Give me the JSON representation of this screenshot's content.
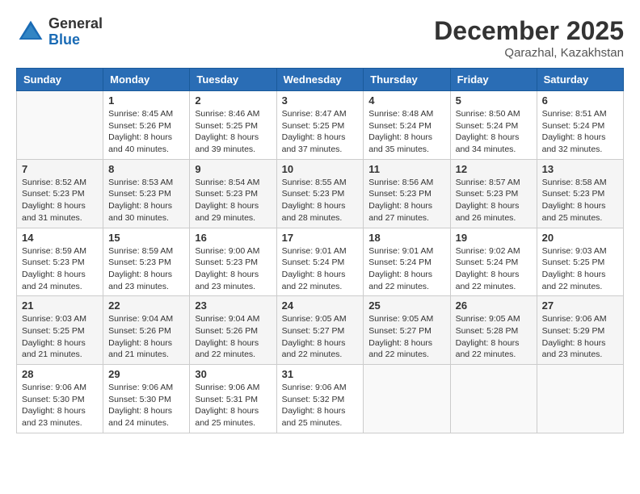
{
  "header": {
    "logo_general": "General",
    "logo_blue": "Blue",
    "month": "December 2025",
    "location": "Qarazhal, Kazakhstan"
  },
  "days_of_week": [
    "Sunday",
    "Monday",
    "Tuesday",
    "Wednesday",
    "Thursday",
    "Friday",
    "Saturday"
  ],
  "weeks": [
    [
      {
        "day": "",
        "sunrise": "",
        "sunset": "",
        "daylight": ""
      },
      {
        "day": "1",
        "sunrise": "Sunrise: 8:45 AM",
        "sunset": "Sunset: 5:26 PM",
        "daylight": "Daylight: 8 hours and 40 minutes."
      },
      {
        "day": "2",
        "sunrise": "Sunrise: 8:46 AM",
        "sunset": "Sunset: 5:25 PM",
        "daylight": "Daylight: 8 hours and 39 minutes."
      },
      {
        "day": "3",
        "sunrise": "Sunrise: 8:47 AM",
        "sunset": "Sunset: 5:25 PM",
        "daylight": "Daylight: 8 hours and 37 minutes."
      },
      {
        "day": "4",
        "sunrise": "Sunrise: 8:48 AM",
        "sunset": "Sunset: 5:24 PM",
        "daylight": "Daylight: 8 hours and 35 minutes."
      },
      {
        "day": "5",
        "sunrise": "Sunrise: 8:50 AM",
        "sunset": "Sunset: 5:24 PM",
        "daylight": "Daylight: 8 hours and 34 minutes."
      },
      {
        "day": "6",
        "sunrise": "Sunrise: 8:51 AM",
        "sunset": "Sunset: 5:24 PM",
        "daylight": "Daylight: 8 hours and 32 minutes."
      }
    ],
    [
      {
        "day": "7",
        "sunrise": "Sunrise: 8:52 AM",
        "sunset": "Sunset: 5:23 PM",
        "daylight": "Daylight: 8 hours and 31 minutes."
      },
      {
        "day": "8",
        "sunrise": "Sunrise: 8:53 AM",
        "sunset": "Sunset: 5:23 PM",
        "daylight": "Daylight: 8 hours and 30 minutes."
      },
      {
        "day": "9",
        "sunrise": "Sunrise: 8:54 AM",
        "sunset": "Sunset: 5:23 PM",
        "daylight": "Daylight: 8 hours and 29 minutes."
      },
      {
        "day": "10",
        "sunrise": "Sunrise: 8:55 AM",
        "sunset": "Sunset: 5:23 PM",
        "daylight": "Daylight: 8 hours and 28 minutes."
      },
      {
        "day": "11",
        "sunrise": "Sunrise: 8:56 AM",
        "sunset": "Sunset: 5:23 PM",
        "daylight": "Daylight: 8 hours and 27 minutes."
      },
      {
        "day": "12",
        "sunrise": "Sunrise: 8:57 AM",
        "sunset": "Sunset: 5:23 PM",
        "daylight": "Daylight: 8 hours and 26 minutes."
      },
      {
        "day": "13",
        "sunrise": "Sunrise: 8:58 AM",
        "sunset": "Sunset: 5:23 PM",
        "daylight": "Daylight: 8 hours and 25 minutes."
      }
    ],
    [
      {
        "day": "14",
        "sunrise": "Sunrise: 8:59 AM",
        "sunset": "Sunset: 5:23 PM",
        "daylight": "Daylight: 8 hours and 24 minutes."
      },
      {
        "day": "15",
        "sunrise": "Sunrise: 8:59 AM",
        "sunset": "Sunset: 5:23 PM",
        "daylight": "Daylight: 8 hours and 23 minutes."
      },
      {
        "day": "16",
        "sunrise": "Sunrise: 9:00 AM",
        "sunset": "Sunset: 5:23 PM",
        "daylight": "Daylight: 8 hours and 23 minutes."
      },
      {
        "day": "17",
        "sunrise": "Sunrise: 9:01 AM",
        "sunset": "Sunset: 5:24 PM",
        "daylight": "Daylight: 8 hours and 22 minutes."
      },
      {
        "day": "18",
        "sunrise": "Sunrise: 9:01 AM",
        "sunset": "Sunset: 5:24 PM",
        "daylight": "Daylight: 8 hours and 22 minutes."
      },
      {
        "day": "19",
        "sunrise": "Sunrise: 9:02 AM",
        "sunset": "Sunset: 5:24 PM",
        "daylight": "Daylight: 8 hours and 22 minutes."
      },
      {
        "day": "20",
        "sunrise": "Sunrise: 9:03 AM",
        "sunset": "Sunset: 5:25 PM",
        "daylight": "Daylight: 8 hours and 22 minutes."
      }
    ],
    [
      {
        "day": "21",
        "sunrise": "Sunrise: 9:03 AM",
        "sunset": "Sunset: 5:25 PM",
        "daylight": "Daylight: 8 hours and 21 minutes."
      },
      {
        "day": "22",
        "sunrise": "Sunrise: 9:04 AM",
        "sunset": "Sunset: 5:26 PM",
        "daylight": "Daylight: 8 hours and 21 minutes."
      },
      {
        "day": "23",
        "sunrise": "Sunrise: 9:04 AM",
        "sunset": "Sunset: 5:26 PM",
        "daylight": "Daylight: 8 hours and 22 minutes."
      },
      {
        "day": "24",
        "sunrise": "Sunrise: 9:05 AM",
        "sunset": "Sunset: 5:27 PM",
        "daylight": "Daylight: 8 hours and 22 minutes."
      },
      {
        "day": "25",
        "sunrise": "Sunrise: 9:05 AM",
        "sunset": "Sunset: 5:27 PM",
        "daylight": "Daylight: 8 hours and 22 minutes."
      },
      {
        "day": "26",
        "sunrise": "Sunrise: 9:05 AM",
        "sunset": "Sunset: 5:28 PM",
        "daylight": "Daylight: 8 hours and 22 minutes."
      },
      {
        "day": "27",
        "sunrise": "Sunrise: 9:06 AM",
        "sunset": "Sunset: 5:29 PM",
        "daylight": "Daylight: 8 hours and 23 minutes."
      }
    ],
    [
      {
        "day": "28",
        "sunrise": "Sunrise: 9:06 AM",
        "sunset": "Sunset: 5:30 PM",
        "daylight": "Daylight: 8 hours and 23 minutes."
      },
      {
        "day": "29",
        "sunrise": "Sunrise: 9:06 AM",
        "sunset": "Sunset: 5:30 PM",
        "daylight": "Daylight: 8 hours and 24 minutes."
      },
      {
        "day": "30",
        "sunrise": "Sunrise: 9:06 AM",
        "sunset": "Sunset: 5:31 PM",
        "daylight": "Daylight: 8 hours and 25 minutes."
      },
      {
        "day": "31",
        "sunrise": "Sunrise: 9:06 AM",
        "sunset": "Sunset: 5:32 PM",
        "daylight": "Daylight: 8 hours and 25 minutes."
      },
      {
        "day": "",
        "sunrise": "",
        "sunset": "",
        "daylight": ""
      },
      {
        "day": "",
        "sunrise": "",
        "sunset": "",
        "daylight": ""
      },
      {
        "day": "",
        "sunrise": "",
        "sunset": "",
        "daylight": ""
      }
    ]
  ]
}
